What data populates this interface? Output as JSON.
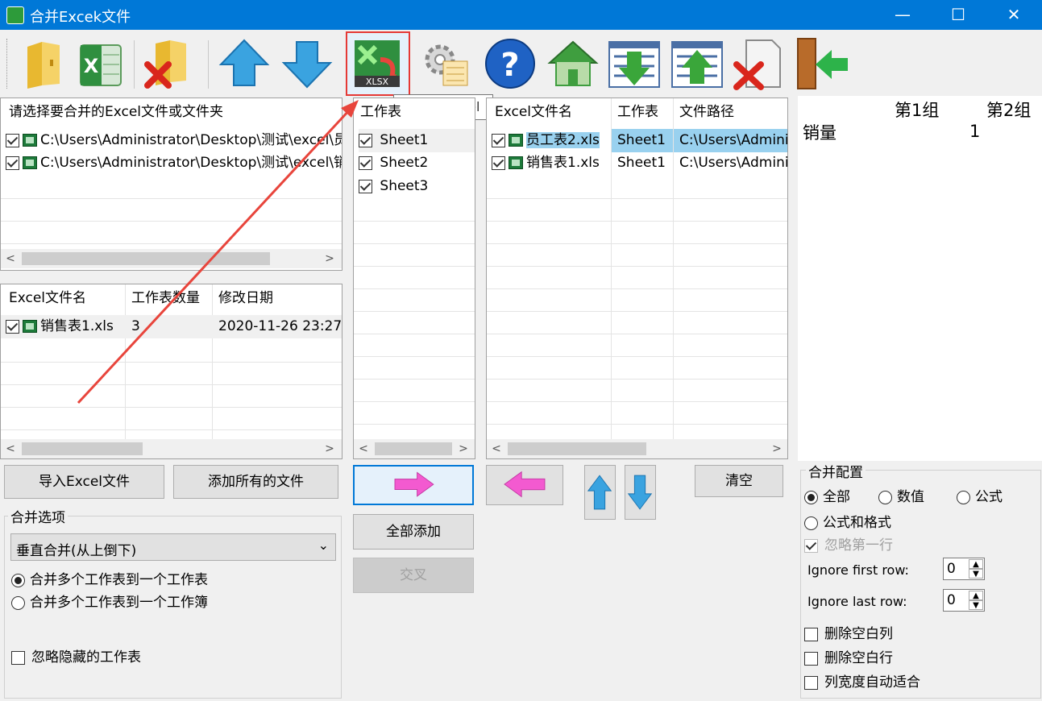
{
  "window": {
    "title": "合并Excek文件",
    "minimize": "—",
    "maximize": "☐",
    "close": "✕"
  },
  "tooltip": "Merge Excel",
  "toolbar": {
    "icons": [
      "open-folder-icon",
      "excel-file-icon",
      "remove-folder-icon",
      "move-up-icon",
      "move-down-icon",
      "merge-excel-icon",
      "settings-icon",
      "help-icon",
      "home-icon",
      "import-list-icon",
      "export-list-icon",
      "delete-file-icon",
      "exit-icon"
    ]
  },
  "source": {
    "header": "请选择要合并的Excel文件或文件夹",
    "items": [
      "C:\\Users\\Administrator\\Desktop\\测试\\excel\\员",
      "C:\\Users\\Administrator\\Desktop\\测试\\excel\\销"
    ]
  },
  "files": {
    "columns": [
      "Excel文件名",
      "工作表数量",
      "修改日期"
    ],
    "rows": [
      {
        "name": "销售表1.xls",
        "count": "3",
        "date": "2020-11-26 23:27:"
      }
    ]
  },
  "sheets": {
    "header": "工作表",
    "items": [
      "Sheet1",
      "Sheet2",
      "Sheet3"
    ]
  },
  "selected": {
    "columns": [
      "Excel文件名",
      "工作表",
      "文件路径"
    ],
    "rows": [
      {
        "name": "员工表2.xls",
        "sheet": "Sheet1",
        "path": "C:\\Users\\Admini"
      },
      {
        "name": "销售表1.xls",
        "sheet": "Sheet1",
        "path": "C:\\Users\\Admini"
      }
    ]
  },
  "preview": {
    "col1": "第1组",
    "col2": "第2组",
    "row_label": "销量",
    "value": "1"
  },
  "buttons": {
    "import": "导入Excel文件",
    "add_all_files": "添加所有的文件",
    "add_all": "全部添加",
    "cross": "交叉",
    "clear": "清空"
  },
  "merge_options": {
    "label": "合并选项",
    "mode": "垂直合并(从上倒下)",
    "radio1": "合并多个工作表到一个工作表",
    "radio2": "合并多个工作表到一个工作簿",
    "ignore_hidden": "忽略隐藏的工作表"
  },
  "merge_config": {
    "label": "合并配置",
    "all": "全部",
    "values": "数值",
    "formula": "公式",
    "formula_format": "公式和格式",
    "ignore_first": "忽略第一行",
    "ignore_first_row": "Ignore first row:",
    "ignore_first_row_value": "0",
    "ignore_last_row": "Ignore last row:",
    "ignore_last_row_value": "0",
    "delete_blank_cols": "删除空白列",
    "delete_blank_rows": "删除空白行",
    "autofit_cols": "列宽度自动适合"
  },
  "colors": {
    "titlebar": "#0078d7",
    "selection": "#99d1ef",
    "arrow": "#e8453c",
    "pink": "#f35ad0"
  }
}
